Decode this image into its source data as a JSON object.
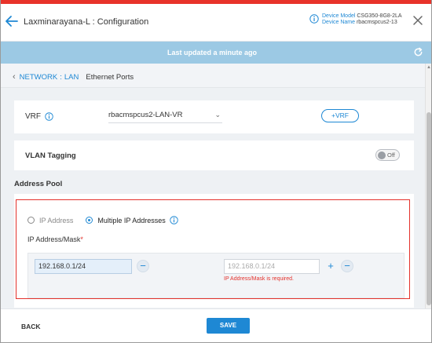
{
  "header": {
    "title": "Laxminarayana-L : Configuration",
    "device_model_label": "Device Model",
    "device_model_value": "CSG350-8G8-2LA",
    "device_name_label": "Device Name",
    "device_name_value": "rbacmspcus2-13"
  },
  "banner": {
    "text": "Last updated a minute ago"
  },
  "breadcrumb": {
    "items": [
      "NETWORK",
      "LAN"
    ],
    "separator": ":",
    "current": "Ethernet Ports"
  },
  "vrf": {
    "label": "VRF",
    "selected": "rbacmspcus2-LAN-VR",
    "add_button": "+VRF"
  },
  "vlan": {
    "label": "VLAN Tagging",
    "toggle_state": "Off"
  },
  "address_pool": {
    "title": "Address Pool",
    "options": [
      "IP Address",
      "Multiple IP Addresses"
    ],
    "selected_option": "Multiple IP Addresses",
    "field_label": "IP Address/Mask",
    "required_marker": "*",
    "entry_1_value": "192.168.0.1/24",
    "entry_2_placeholder": "192.168.0.1/24",
    "error_message": "IP Address/Mask is required."
  },
  "footer": {
    "back_label": "BACK",
    "save_label": "SAVE"
  },
  "colors": {
    "accent": "#1e88d4",
    "error": "#e4312b",
    "banner": "#9cc9e4"
  }
}
